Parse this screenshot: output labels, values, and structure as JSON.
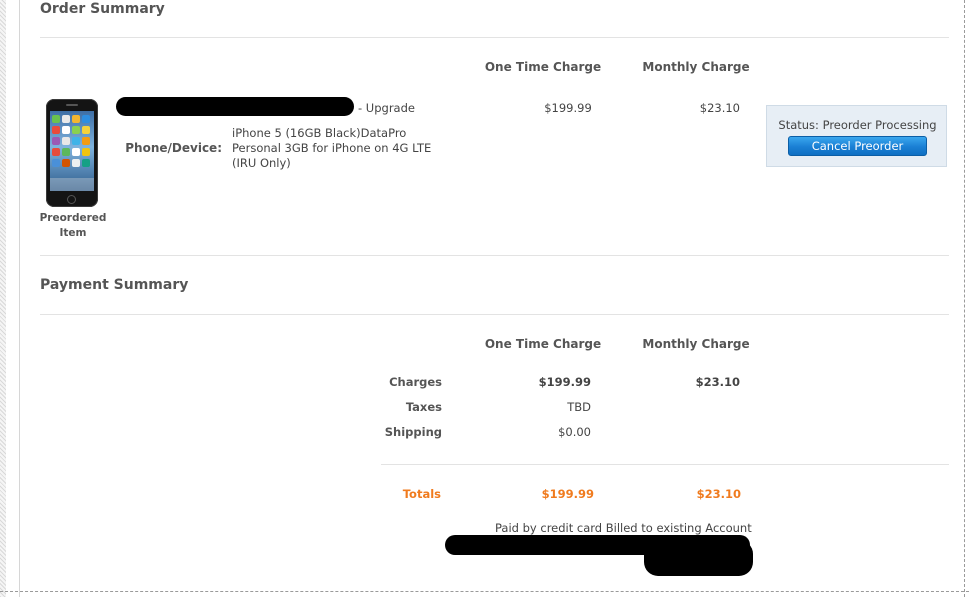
{
  "order_summary": {
    "title": "Order Summary",
    "col_one_time": "One Time Charge",
    "col_monthly": "Monthly Charge",
    "item": {
      "upgrade_label": "- Upgrade",
      "one_time": "$199.99",
      "monthly": "$23.10",
      "image_caption_line1": "Preordered",
      "image_caption_line2": "Item",
      "device_label": "Phone/Device:",
      "device_line1": "iPhone 5 (16GB Black)DataPro",
      "device_line2": "Personal 3GB for iPhone on 4G LTE",
      "device_line3": "(IRU Only)"
    },
    "status": {
      "text": "Status: Preorder Processing",
      "cancel_button": "Cancel Preorder"
    }
  },
  "payment_summary": {
    "title": "Payment Summary",
    "col_one_time": "One Time Charge",
    "col_monthly": "Monthly Charge",
    "rows": [
      {
        "label": "Charges",
        "one_time": "$199.99",
        "monthly": "$23.10"
      },
      {
        "label": "Taxes",
        "one_time": "TBD",
        "monthly": ""
      },
      {
        "label": "Shipping",
        "one_time": "$0.00",
        "monthly": ""
      }
    ],
    "totals": {
      "label": "Totals",
      "one_time": "$199.99",
      "monthly": "$23.10"
    },
    "paid_by": "Paid by credit card Billed to existing Account"
  },
  "colors": {
    "accent_orange": "#f07b1e",
    "button_blue": "#1a7fd4",
    "status_bg": "#e7eef5"
  }
}
